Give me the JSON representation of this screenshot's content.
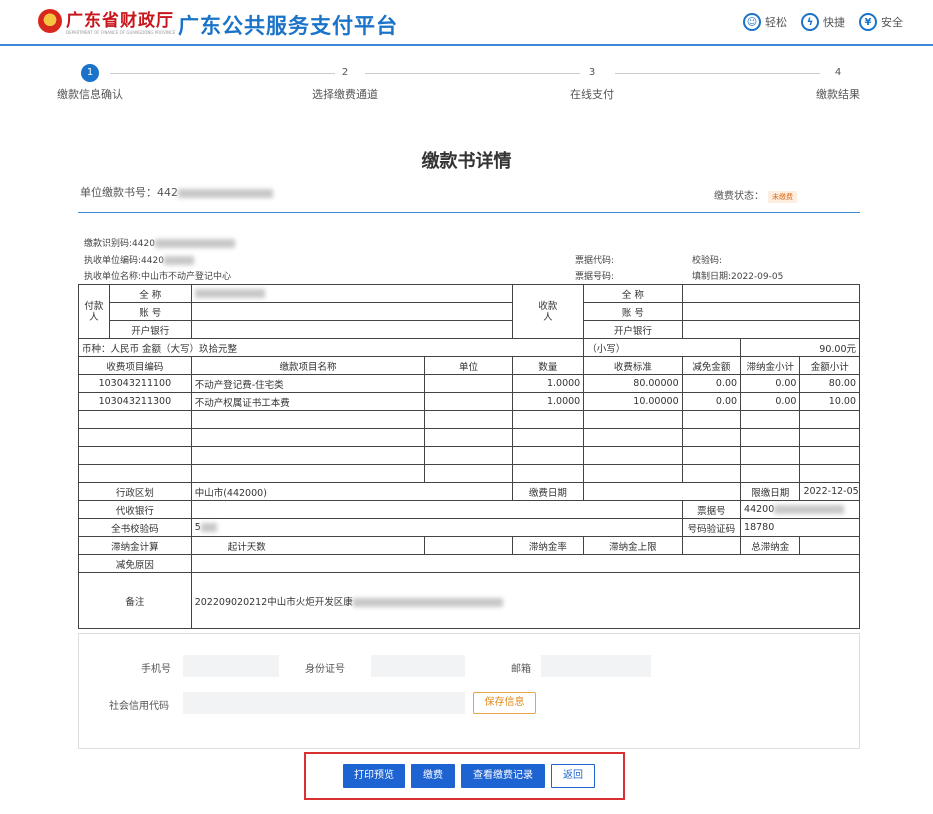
{
  "header": {
    "logo_text": "广东省财政厅",
    "logo_sub": "DEPARTMENT OF FINANCE OF GUANGDONG PROVINCE",
    "site_title": "广东公共服务支付平台",
    "links": [
      {
        "icon": "smile-icon",
        "label": "轻松"
      },
      {
        "icon": "lightning-icon",
        "label": "快捷"
      },
      {
        "icon": "shield-icon",
        "label": "安全"
      }
    ],
    "accent": "#1a73c8"
  },
  "steps": [
    {
      "num": "1",
      "label": "缴款信息确认",
      "active": true
    },
    {
      "num": "2",
      "label": "选择缴费通道",
      "active": false
    },
    {
      "num": "3",
      "label": "在线支付",
      "active": false
    },
    {
      "num": "4",
      "label": "缴款结果",
      "active": false
    }
  ],
  "detail": {
    "title": "缴款书详情",
    "bill_no_label": "单位缴款书号：442",
    "status_label": "缴费状态：",
    "status_value": "未缴费"
  },
  "meta": {
    "payment_id": "缴款识别码:4420",
    "payee_code": "执收单位编码:4420",
    "payee_name": "执收单位名称:中山市不动产登记中心",
    "ticket_code": "票据代码:",
    "ticket_no": "票据号码:",
    "check_code": "校验码:",
    "fill_date": "填制日期:2022-09-05"
  },
  "table": {
    "payer_label": "付款人",
    "payee_label": "收款人",
    "full_name": "全  称",
    "account": "账  号",
    "bank": "开户银行",
    "currency": "币种：人民币  金额（大写）玖拾元整",
    "small_label": "（小写）",
    "amount": "90.00元",
    "headers": [
      "收费项目编码",
      "缴款项目名称",
      "单位",
      "数量",
      "收费标准",
      "减免金额",
      "滞纳金小计",
      "金额小计"
    ],
    "rows": [
      [
        "103043211100",
        "不动产登记费-住宅类",
        "",
        "1.0000",
        "80.00000",
        "0.00",
        "0.00",
        "80.00"
      ],
      [
        "103043211300",
        "不动产权属证书工本费",
        "",
        "1.0000",
        "10.00000",
        "0.00",
        "0.00",
        "10.00"
      ]
    ],
    "region_label": "行政区划",
    "region_value": "中山市(442000)",
    "pay_date_label": "缴费日期",
    "limit_date_label": "限缴日期",
    "limit_date_value": "2022-12-05",
    "bank_label": "代收银行",
    "ticket_label": "票据号",
    "ticket_value": "44200",
    "book_check_label": "全书校验码",
    "book_check_value": "5",
    "num_check_label": "号码验证码",
    "num_check_value": "18780",
    "late_calc_label": "滞纳金计算",
    "start_days_label": "起计天数",
    "late_rate_label": "滞纳金率",
    "late_cap_label": "滞纳金上限",
    "total_late_label": "总滞纳金",
    "reduce_reason_label": "减免原因",
    "remark_label": "备注",
    "remark_value": "202209020212中山市火炬开发区康"
  },
  "contact": {
    "phone_label": "手机号",
    "id_label": "身份证号",
    "email_label": "邮箱",
    "credit_label": "社会信用代码",
    "save_label": "保存信息"
  },
  "actions": {
    "print": "打印预览",
    "pay": "缴费",
    "records": "查看缴费记录",
    "back": "返回"
  }
}
